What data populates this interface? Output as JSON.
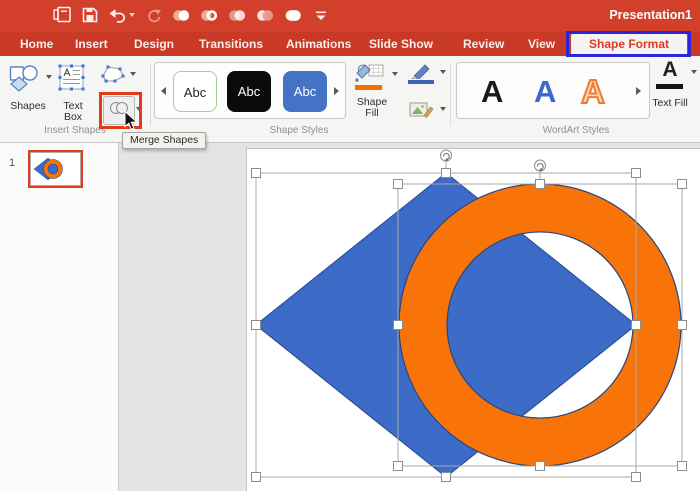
{
  "window": {
    "title": "Presentation1"
  },
  "tabs": {
    "items": [
      "Home",
      "Insert",
      "Design",
      "Transitions",
      "Animations",
      "Slide Show",
      "Review",
      "View",
      "Shape Format"
    ],
    "active": "Shape Format"
  },
  "ribbon": {
    "insert_shapes": {
      "group_label": "Insert Shapes",
      "shapes_label": "Shapes",
      "text_box_line1": "Text",
      "text_box_line2": "Box"
    },
    "shape_styles": {
      "group_label": "Shape Styles",
      "swatch_text": "Abc",
      "fill_line1": "Shape",
      "fill_line2": "Fill"
    },
    "wordart": {
      "group_label": "WordArt Styles",
      "sample_letter": "A",
      "text_fill_label": "Text Fill"
    }
  },
  "tooltip": {
    "text": "Merge Shapes"
  },
  "slide_panel": {
    "slide_number": "1"
  },
  "canvas": {
    "shapes": [
      {
        "type": "diamond",
        "fill": "#3D6CC8"
      },
      {
        "type": "donut",
        "fill": "#F87408"
      }
    ]
  },
  "colors": {
    "titlebar_red": "#D2402B",
    "tabbar_red": "#C93A26",
    "annotation_red": "#E43A19",
    "annotation_blue": "#2B24D8",
    "shape_blue": "#3D6CC8",
    "shape_blue_outline": "#2B4F9B",
    "shape_orange": "#F87408",
    "shape_orange_outline": "#26477E",
    "active_tab_text": "#DF3A27",
    "style_swatch_blue": "#4472C4",
    "wordart_blue": "#3B69C7",
    "wordart_orange": "#ED7D31"
  }
}
